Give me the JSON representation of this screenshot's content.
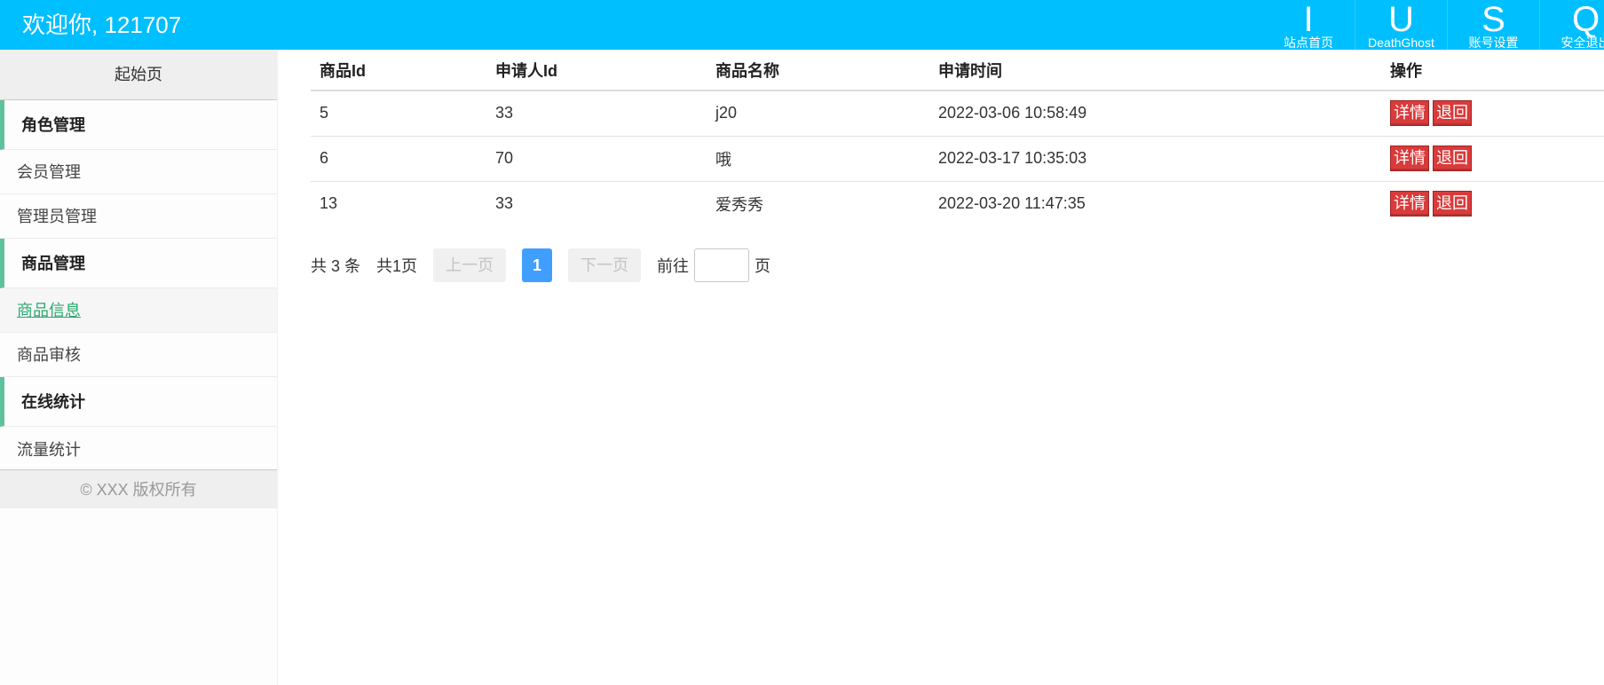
{
  "header": {
    "welcome": "欢迎你, 121707",
    "nav": [
      {
        "letter": "I",
        "label": "站点首页"
      },
      {
        "letter": "U",
        "label": "DeathGhost"
      },
      {
        "letter": "S",
        "label": "账号设置"
      },
      {
        "letter": "Q",
        "label": "安全退出"
      }
    ]
  },
  "sidebar": {
    "start_page": "起始页",
    "groups": [
      {
        "title": "角色管理",
        "items": [
          "会员管理",
          "管理员管理"
        ]
      },
      {
        "title": "商品管理",
        "items": [
          "商品信息",
          "商品审核"
        ]
      },
      {
        "title": "在线统计",
        "items": [
          "流量统计"
        ]
      }
    ],
    "active_item": "商品信息",
    "copyright": "© XXX 版权所有"
  },
  "table": {
    "headers": [
      "商品Id",
      "申请人Id",
      "商品名称",
      "申请时间",
      "操作"
    ],
    "rows": [
      {
        "id": "5",
        "applicant": "33",
        "name": "j20",
        "time": "2022-03-06 10:58:49"
      },
      {
        "id": "6",
        "applicant": "70",
        "name": "哦",
        "time": "2022-03-17 10:35:03"
      },
      {
        "id": "13",
        "applicant": "33",
        "name": "爱秀秀",
        "time": "2022-03-20 11:47:35"
      }
    ],
    "actions": {
      "detail": "详情",
      "return": "退回"
    }
  },
  "pagination": {
    "total": "共 3 条",
    "pages": "共1页",
    "prev": "上一页",
    "current": "1",
    "next": "下一页",
    "goto": "前往",
    "goto_value": "",
    "page_unit": "页"
  },
  "colors": {
    "header_bg": "#00bfff",
    "accent_green": "#5fc29b",
    "button_red": "#d93b3b",
    "pager_active": "#409eff"
  }
}
